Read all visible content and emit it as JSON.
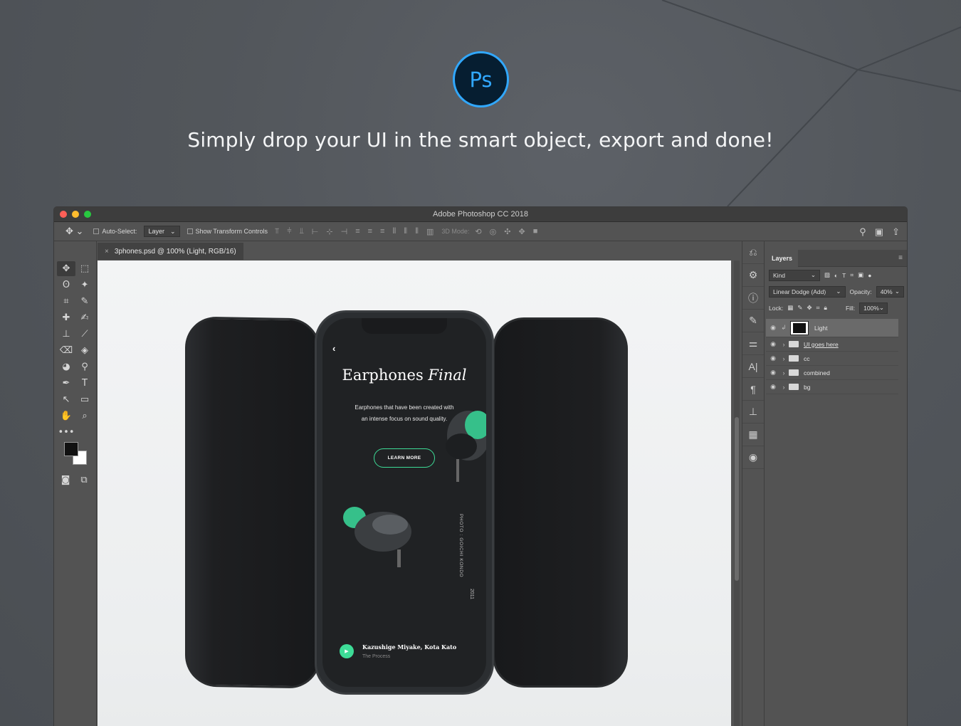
{
  "marketing": {
    "logo_text": "Ps",
    "headline": "Simply drop your UI in the smart object, export and done!"
  },
  "window": {
    "title": "Adobe Photoshop CC 2018"
  },
  "options_bar": {
    "auto_select_label": "Auto-Select:",
    "auto_select_value": "Layer",
    "transform_label": "Show Transform Controls",
    "mode_label": "3D Mode:"
  },
  "document": {
    "tab_close": "×",
    "tab_title": "3phones.psd @ 100% (Light, RGB/16)"
  },
  "tools": [
    "✥",
    "⬚",
    "ʘ",
    "✦",
    "⌗",
    "✎",
    "✚",
    "✍",
    "⊥",
    "⟋",
    "⌫",
    "◈",
    "◕",
    "⚲",
    "✒",
    "T",
    "↖",
    "▭",
    "✋",
    "⌕",
    "•••"
  ],
  "layers_panel": {
    "tab": "Layers",
    "menu": "≡",
    "filter_kind": "Kind",
    "blend_mode": "Linear Dodge (Add)",
    "opacity_label": "Opacity:",
    "opacity_value": "40%",
    "lock_label": "Lock:",
    "fill_label": "Fill:",
    "fill_value": "100%",
    "layers": [
      {
        "name": "Light",
        "type": "smart",
        "visible": true,
        "selected": true
      },
      {
        "name": "UI goes here",
        "type": "folder",
        "visible": true
      },
      {
        "name": "cc",
        "type": "folder",
        "visible": true
      },
      {
        "name": "combined",
        "type": "folder",
        "visible": true
      },
      {
        "name": "bg",
        "type": "folder",
        "visible": true
      }
    ]
  },
  "app_screen": {
    "back": "‹",
    "title_regular": "Earphones",
    "title_italic": "Final",
    "description": "Earphones that have been created with an intense focus on sound quality.",
    "button": "LEARN MORE",
    "credit": "PHOTO : GOICHI KONDO",
    "year": "2011",
    "artist": "Kazushige Miyake, Kota Kato",
    "subtitle": "The Process"
  },
  "colors": {
    "ps_blue": "#31a8ff",
    "accent_green": "#3ddc97"
  }
}
